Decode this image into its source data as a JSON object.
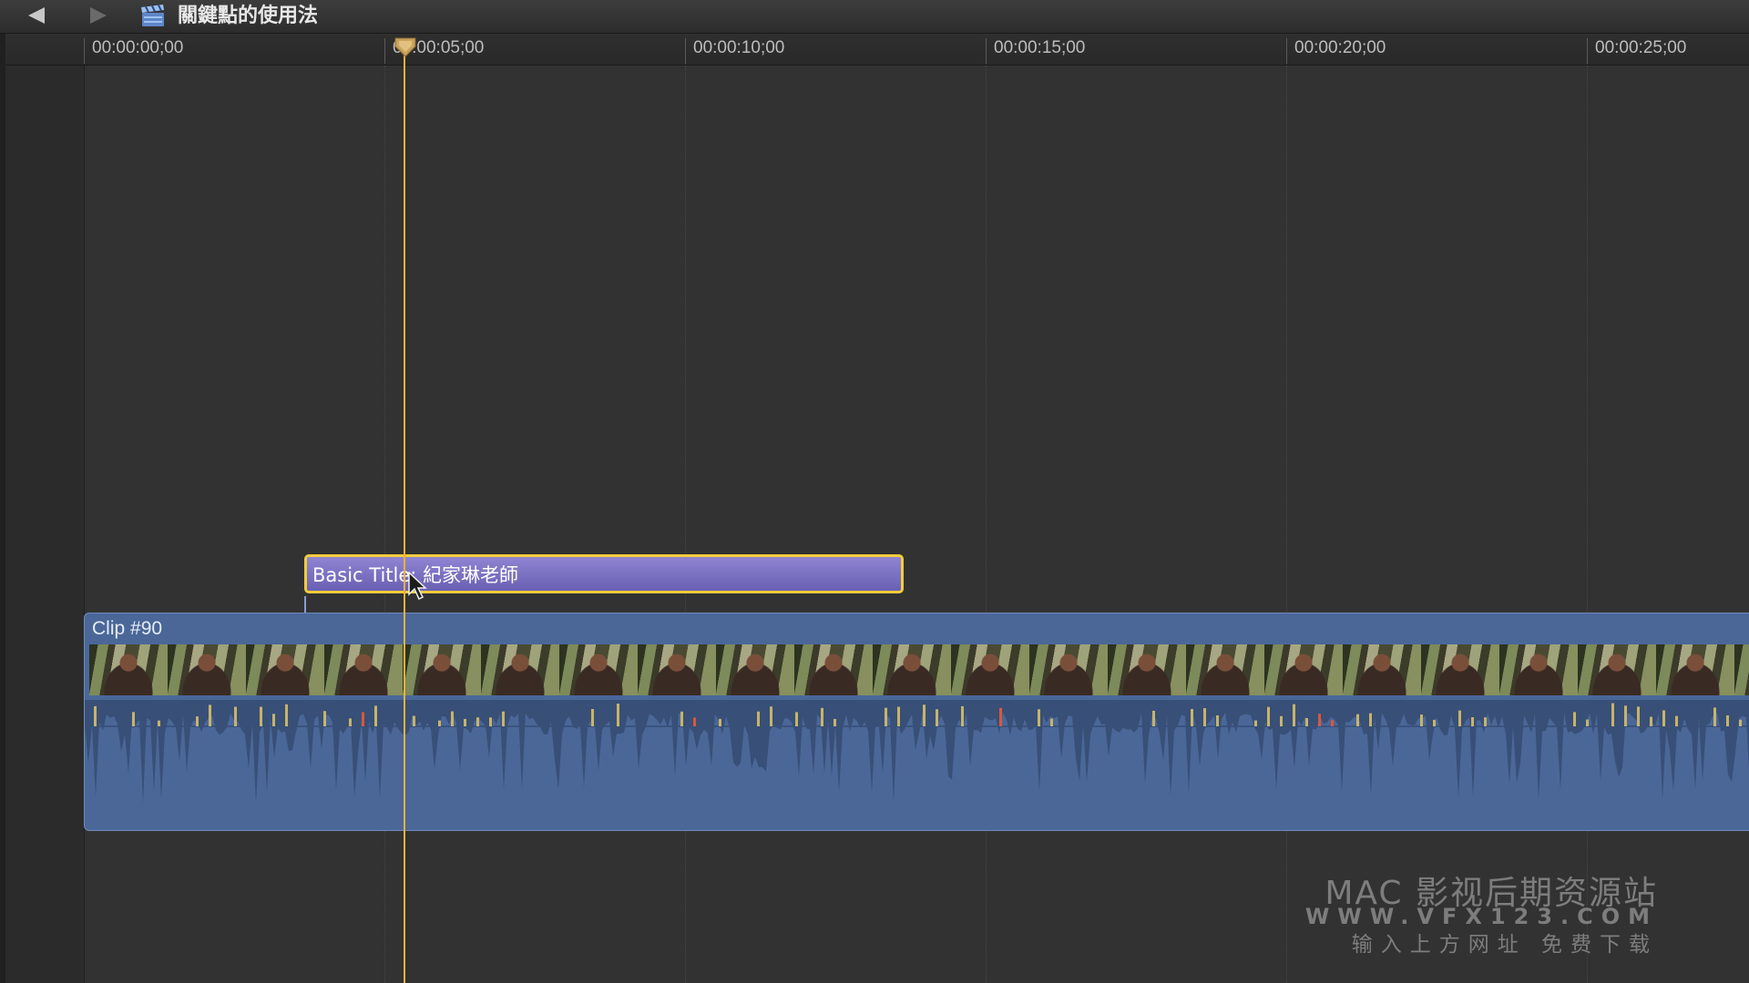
{
  "window": {
    "project_title": "關鍵點的使用法",
    "back_icon": "back-arrow-icon",
    "forward_icon": "forward-arrow-icon",
    "project_icon": "clapperboard-icon"
  },
  "ruler": {
    "labels": [
      "00:00:00;00",
      "00:00:05;00",
      "00:00:10;00",
      "00:00:15;00",
      "00:00:20;00",
      "00:00:25;00"
    ]
  },
  "playhead": {
    "position": "00:00:05;00",
    "color": "#f0b23a"
  },
  "title_clip": {
    "label": "Basic Title: 紀家琳老師",
    "color": "#7a6fc4",
    "selected_border": "#f2cc3a"
  },
  "main_clip": {
    "name": "Clip #90",
    "color": "#4a6798"
  },
  "watermark": {
    "line1": "MAC 影视后期资源站",
    "line2": "WWW.VFX123.COM",
    "line3": "输入上方网址 免费下载"
  }
}
